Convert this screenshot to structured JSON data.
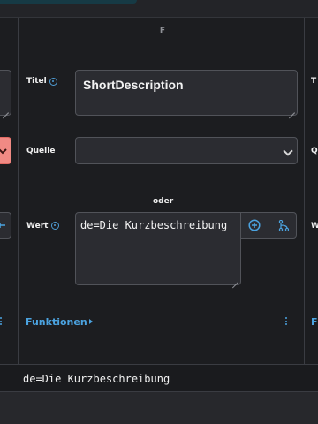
{
  "column": {
    "letter": "F"
  },
  "fields": {
    "title_label": "Titel",
    "title_value": "ShortDescription",
    "source_label": "Quelle",
    "source_value": "",
    "or_label": "oder",
    "value_label": "Wert",
    "value_value": "de=Die Kurzbeschreibung"
  },
  "functions": {
    "label": "Funktionen"
  },
  "neighbors": {
    "right_title_label": "T",
    "right_source_label": "Q",
    "right_value_label": "W",
    "right_functions_label": "F"
  },
  "result_row": {
    "value": "de=Die Kurzbeschreibung"
  },
  "icons": {
    "help": "info-circle-icon",
    "add": "plus-circle-icon",
    "mapping": "branch-icon",
    "dropdown": "chevron-down-icon",
    "more": "kebab-menu-icon"
  },
  "colors": {
    "accent": "#4ba3e0",
    "danger_button": "#f08a84"
  }
}
